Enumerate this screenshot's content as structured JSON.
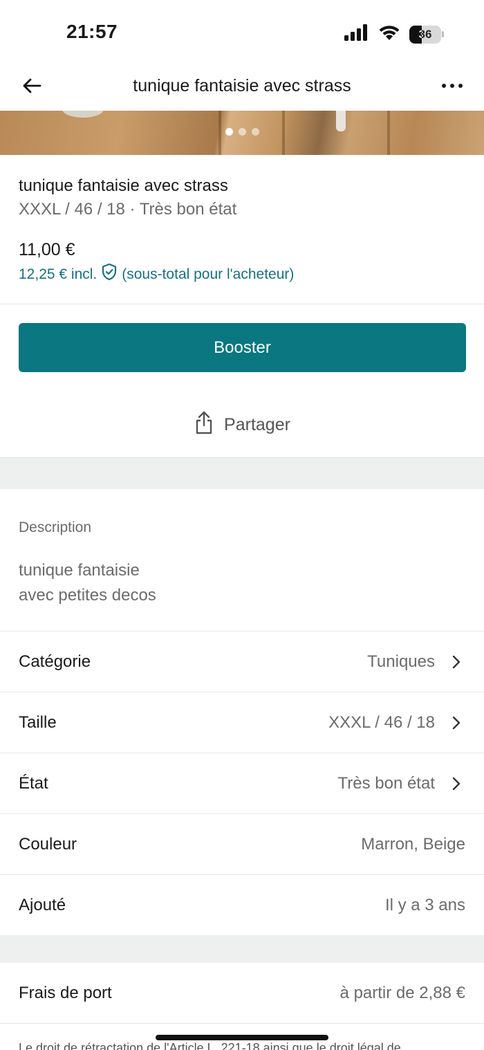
{
  "status": {
    "time": "21:57",
    "battery": "36"
  },
  "nav": {
    "title": "tunique fantaisie avec strass"
  },
  "gallery": {
    "photo_count": 3,
    "active_photo": 1
  },
  "item": {
    "title": "tunique fantaisie avec strass",
    "subtitle": "XXXL / 46 / 18 · Très bon état",
    "price": "11,00 €",
    "price_incl": "12,25 € incl.",
    "price_incl_note": "(sous-total pour l'acheteur)"
  },
  "actions": {
    "booster_label": "Booster",
    "share_label": "Partager"
  },
  "description": {
    "label": "Description",
    "line1": "tunique fantaisie",
    "line2": "avec petites decos"
  },
  "attributes": [
    {
      "label": "Catégorie",
      "value": "Tuniques"
    },
    {
      "label": "Taille",
      "value": "XXXL / 46 / 18"
    },
    {
      "label": "État",
      "value": "Très bon état"
    },
    {
      "label": "Couleur",
      "value": "Marron, Beige"
    },
    {
      "label": "Ajouté",
      "value": "Il y a 3 ans"
    }
  ],
  "shipping": {
    "label": "Frais de port",
    "value": "à partir de 2,88 €"
  },
  "legal": {
    "text": "Le droit de rétractation de l'Article L. 221-18 ainsi que le droit légal de"
  },
  "colors": {
    "accent": "#0a7781",
    "accent_text": "#177082",
    "divider_band": "#eef0f0"
  }
}
